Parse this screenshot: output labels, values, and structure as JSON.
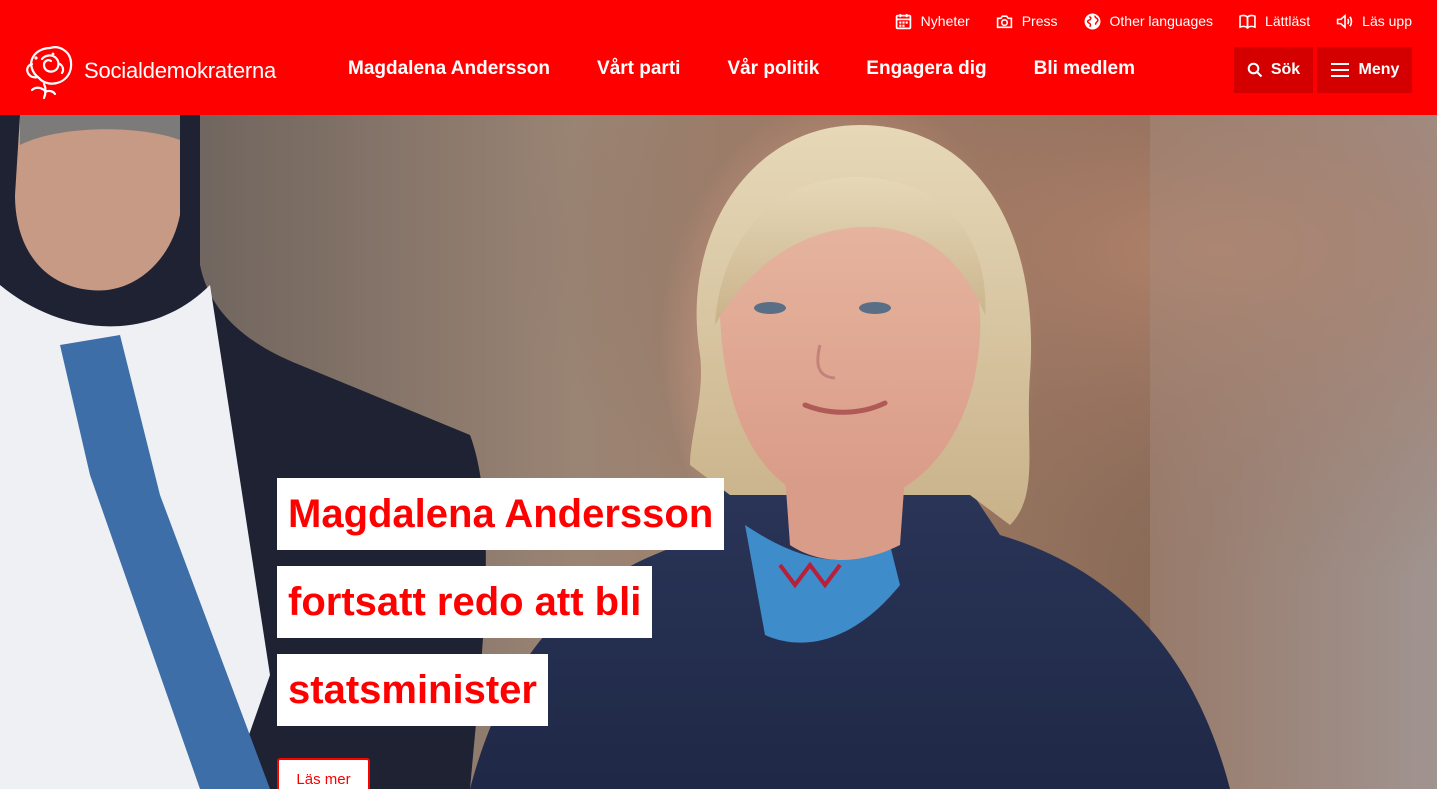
{
  "topbar": {
    "items": [
      {
        "label": "Nyheter",
        "icon": "calendar-icon"
      },
      {
        "label": "Press",
        "icon": "camera-icon"
      },
      {
        "label": "Other languages",
        "icon": "globe-icon"
      },
      {
        "label": "Lättläst",
        "icon": "book-icon"
      },
      {
        "label": "Läs upp",
        "icon": "speaker-icon"
      }
    ]
  },
  "logo": {
    "text": "Socialdemokraterna",
    "icon": "rose-logo-icon"
  },
  "nav": {
    "items": [
      {
        "label": "Magdalena Andersson"
      },
      {
        "label": "Vårt parti"
      },
      {
        "label": "Vår politik"
      },
      {
        "label": "Engagera dig"
      },
      {
        "label": "Bli medlem"
      }
    ]
  },
  "search": {
    "label": "Sök",
    "icon": "search-icon"
  },
  "menu": {
    "label": "Meny",
    "icon": "hamburger-icon"
  },
  "hero": {
    "headline_lines": [
      "Magdalena Andersson",
      "fortsatt redo att bli",
      "statsminister"
    ],
    "cta_label": "Läs mer"
  },
  "colors": {
    "brand_red": "#ff0000",
    "button_dark_red": "#d40000",
    "white": "#ffffff"
  }
}
